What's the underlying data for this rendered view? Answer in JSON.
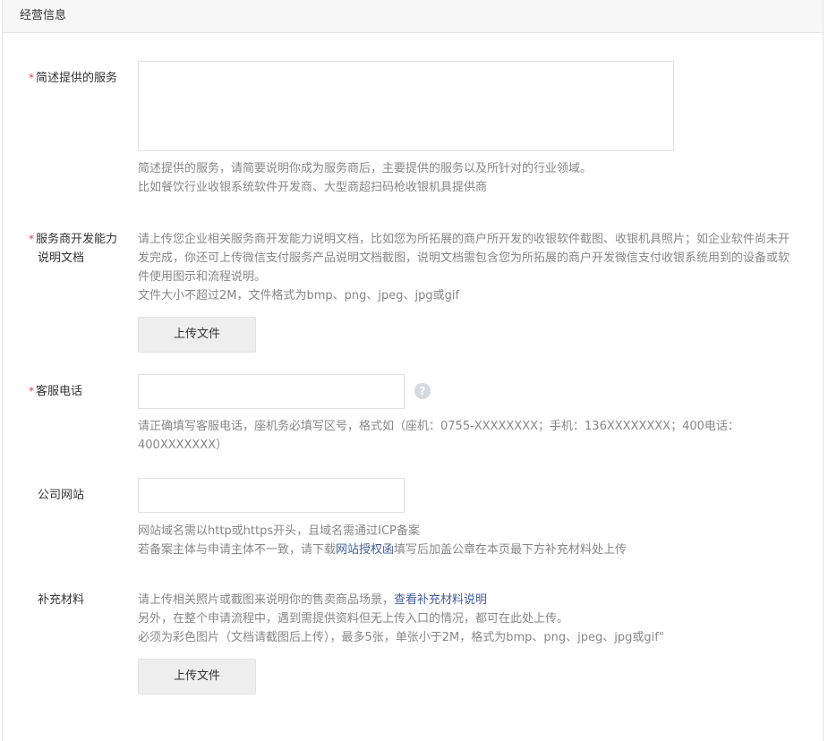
{
  "section": {
    "title": "经营信息"
  },
  "required_mark": "*",
  "service_desc": {
    "label": "简述提供的服务",
    "value": "",
    "hint_lines": [
      "简述提供的服务，请简要说明你成为服务商后，主要提供的服务以及所针对的行业领域。",
      "比如餐饮行业收银系统软件开发商、大型商超扫码枪收银机具提供商"
    ]
  },
  "capability_doc": {
    "label_line1": "服务商开发能力",
    "label_line2": "说明文档",
    "hint_lines": [
      "请上传您企业相关服务商开发能力说明文档，比如您为所拓展的商户所开发的收银软件截图、收银机具照片；如企业软件尚未开发完成，你还可上传微信支付服务产品说明文档截图，说明文档需包含您为所拓展的商户开发微信支付收银系统用到的设备或软件使用图示和流程说明。",
      "文件大小不超过2M，文件格式为bmp、png、jpeg、jpg或gif"
    ],
    "upload_label": "上传文件"
  },
  "service_phone": {
    "label": "客服电话",
    "value": "",
    "help_icon": "question-circle-icon",
    "help_glyph": "?",
    "hint": "请正确填写客服电话，座机务必填写区号，格式如（座机：0755-XXXXXXXX；手机：136XXXXXXXX；400电话：400XXXXXXX）"
  },
  "website": {
    "label": "公司网站",
    "value": "",
    "hint_line1": "网站域名需以http或https开头，且域名需通过ICP备案",
    "hint_line2_before": "若备案主体与申请主体不一致，请下载",
    "hint_line2_link": "网站授权函",
    "hint_line2_after": "填写后加盖公章在本页最下方补充材料处上传"
  },
  "supplement": {
    "label": "补充材料",
    "hint_line1_before": "请上传相关照片或截图来说明你的售卖商品场景，",
    "hint_line1_link": "查看补充材料说明",
    "hint_line2": "另外，在整个申请流程中，遇到需提供资料但无上传入口的情况，都可在此处上传。",
    "hint_line3": "必须为彩色图片（文档请截图后上传），最多5张，单张小于2M，格式为bmp、png、jpeg、jpg或gif\"",
    "upload_label": "上传文件"
  },
  "colors": {
    "required": "#e64340",
    "hint": "#888888",
    "link": "#445c9c",
    "header_bg": "#f7f7f7",
    "button_bg": "#eeeeee"
  }
}
